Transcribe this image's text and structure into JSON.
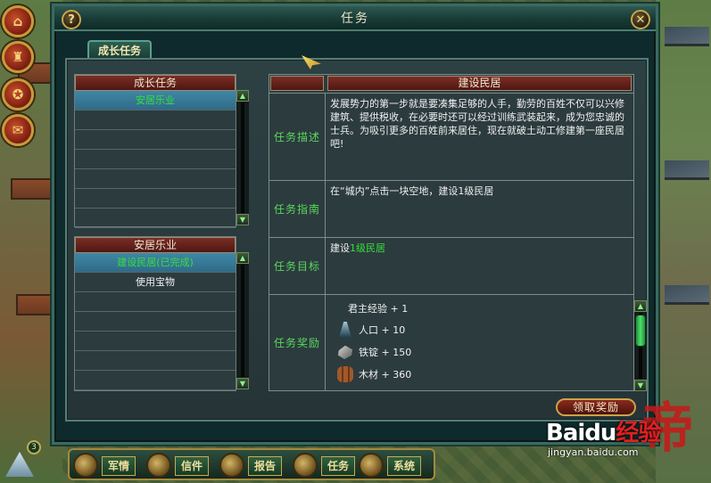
{
  "window": {
    "title": "任务",
    "help_label": "?",
    "close_label": "✕"
  },
  "tab_label": "成长任务",
  "growth_list": {
    "header": "成长任务",
    "items": [
      "安居乐业",
      "",
      "",
      "",
      "",
      "",
      ""
    ]
  },
  "sub_list": {
    "header": "安居乐业",
    "items": [
      "建设民居(已完成)",
      "使用宝物",
      "",
      "",
      "",
      "",
      ""
    ]
  },
  "detail": {
    "header": "建设民居",
    "description_label": "任务描述",
    "description": "发展势力的第一步就是要凑集足够的人手，勤劳的百姓不仅可以兴修建筑、提供税收，在必要时还可以经过训练武装起来，成为您忠诚的士兵。为吸引更多的百姓前来居住，现在就破土动工修建第一座民居吧!",
    "guide_label": "任务指南",
    "guide": "在“城内”点击一块空地，建设1级民居",
    "goal_label": "任务目标",
    "goal_prefix": "建设",
    "goal_highlight": "1级民居",
    "reward_label": "任务奖励",
    "rewards": [
      {
        "icon": "none",
        "text": "君主经验 + 1"
      },
      {
        "icon": "population-icon",
        "text": "人口 + 10"
      },
      {
        "icon": "iron-ingot-icon",
        "text": "铁锭 + 150"
      },
      {
        "icon": "wood-icon",
        "text": "木材 + 360"
      }
    ]
  },
  "claim_button": "领取奖励",
  "toolbar": {
    "badge": "3",
    "buttons": [
      "军情",
      "信件",
      "报告",
      "任务",
      "系统"
    ]
  },
  "watermark": {
    "brand": "Baidu",
    "suffix": "经验",
    "url": "jingyan.baidu.com",
    "seal_char": "帝"
  }
}
